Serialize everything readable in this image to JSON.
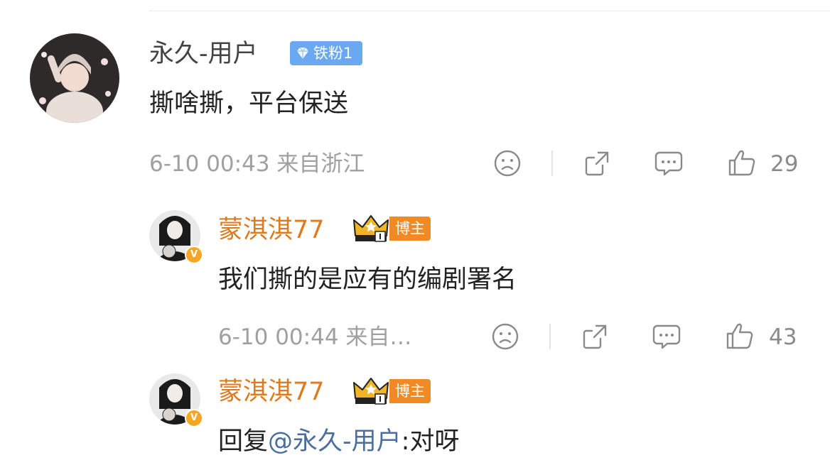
{
  "comment": {
    "user": "永久-用户",
    "fan_badge": "铁粉1",
    "text": "撕啥撕，平台保送",
    "time_location": "6-10 00:43  来自浙江",
    "likes": "29"
  },
  "reply1": {
    "user": "蒙淇淇77",
    "host_badge": "博主",
    "verified": "V",
    "text": "我们撕的是应有的编剧署名",
    "time_location": "6-10 00:44  来自…",
    "likes": "43"
  },
  "reply2": {
    "user": "蒙淇淇77",
    "host_badge": "博主",
    "verified": "V",
    "reply_prefix": "回复",
    "mention": "@永久-用户",
    "text": ":对呀"
  },
  "colors": {
    "username_orange": "#e07a1f",
    "fan_badge_blue": "#6aa9f2",
    "host_badge_orange": "#f08a24",
    "mention_blue": "#4a6f9e",
    "meta_gray": "#a0a0a0"
  },
  "icons": [
    "sad-face-icon",
    "share-icon",
    "comment-icon",
    "thumbs-up-icon",
    "crown-icon",
    "diamond-icon"
  ]
}
